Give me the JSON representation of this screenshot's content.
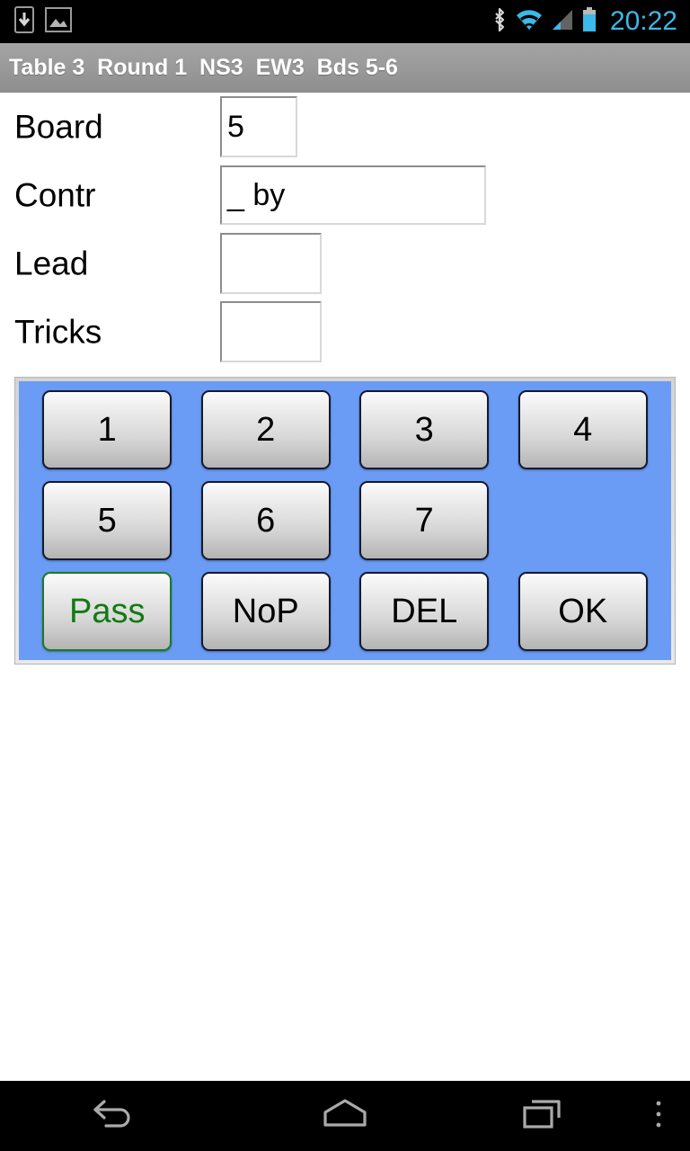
{
  "status_bar": {
    "left_icons": [
      {
        "name": "download-icon",
        "label": "download"
      },
      {
        "name": "screenshot-image-icon",
        "label": "image"
      }
    ],
    "right_icons": [
      {
        "name": "bluetooth-icon",
        "label": "bluetooth"
      },
      {
        "name": "wifi-icon",
        "label": "wifi"
      },
      {
        "name": "cellular-signal-icon",
        "label": "signal"
      },
      {
        "name": "battery-icon",
        "label": "battery"
      }
    ],
    "clock": "20:22",
    "accent_color": "#3bb9e8",
    "background_color": "#000000"
  },
  "title_bar": {
    "text": "Table 3  Round 1  NS3  EW3  Bds 5-6",
    "table": "Table 3",
    "round": "Round 1",
    "ns": "NS3",
    "ew": "EW3",
    "boards": "Bds 5-6",
    "background_color": "#9b9b9b",
    "text_color": "#ffffff"
  },
  "form": {
    "rows": [
      {
        "label": "Board",
        "value": "5",
        "placeholder": ""
      },
      {
        "label": "Contr",
        "value": "_ by",
        "placeholder": ""
      },
      {
        "label": "Lead",
        "value": "",
        "placeholder": ""
      },
      {
        "label": "Tricks",
        "value": "",
        "placeholder": ""
      }
    ]
  },
  "keypad": {
    "background_color": "#6a9cf5",
    "rows": [
      [
        {
          "label": "1",
          "style": "normal"
        },
        {
          "label": "2",
          "style": "normal"
        },
        {
          "label": "3",
          "style": "normal"
        },
        {
          "label": "4",
          "style": "normal"
        }
      ],
      [
        {
          "label": "5",
          "style": "normal"
        },
        {
          "label": "6",
          "style": "normal"
        },
        {
          "label": "7",
          "style": "normal"
        },
        {
          "label": "",
          "style": "empty"
        }
      ],
      [
        {
          "label": "Pass",
          "style": "green"
        },
        {
          "label": "NoP",
          "style": "normal"
        },
        {
          "label": "DEL",
          "style": "normal"
        },
        {
          "label": "OK",
          "style": "normal"
        }
      ]
    ],
    "highlight_color": "#137a13"
  },
  "nav_bar": {
    "buttons": [
      {
        "name": "nav-back-button",
        "label": "Back"
      },
      {
        "name": "nav-home-button",
        "label": "Home"
      },
      {
        "name": "nav-recents-button",
        "label": "Recent apps"
      },
      {
        "name": "nav-menu-button",
        "label": "Menu"
      }
    ],
    "background_color": "#000000"
  }
}
